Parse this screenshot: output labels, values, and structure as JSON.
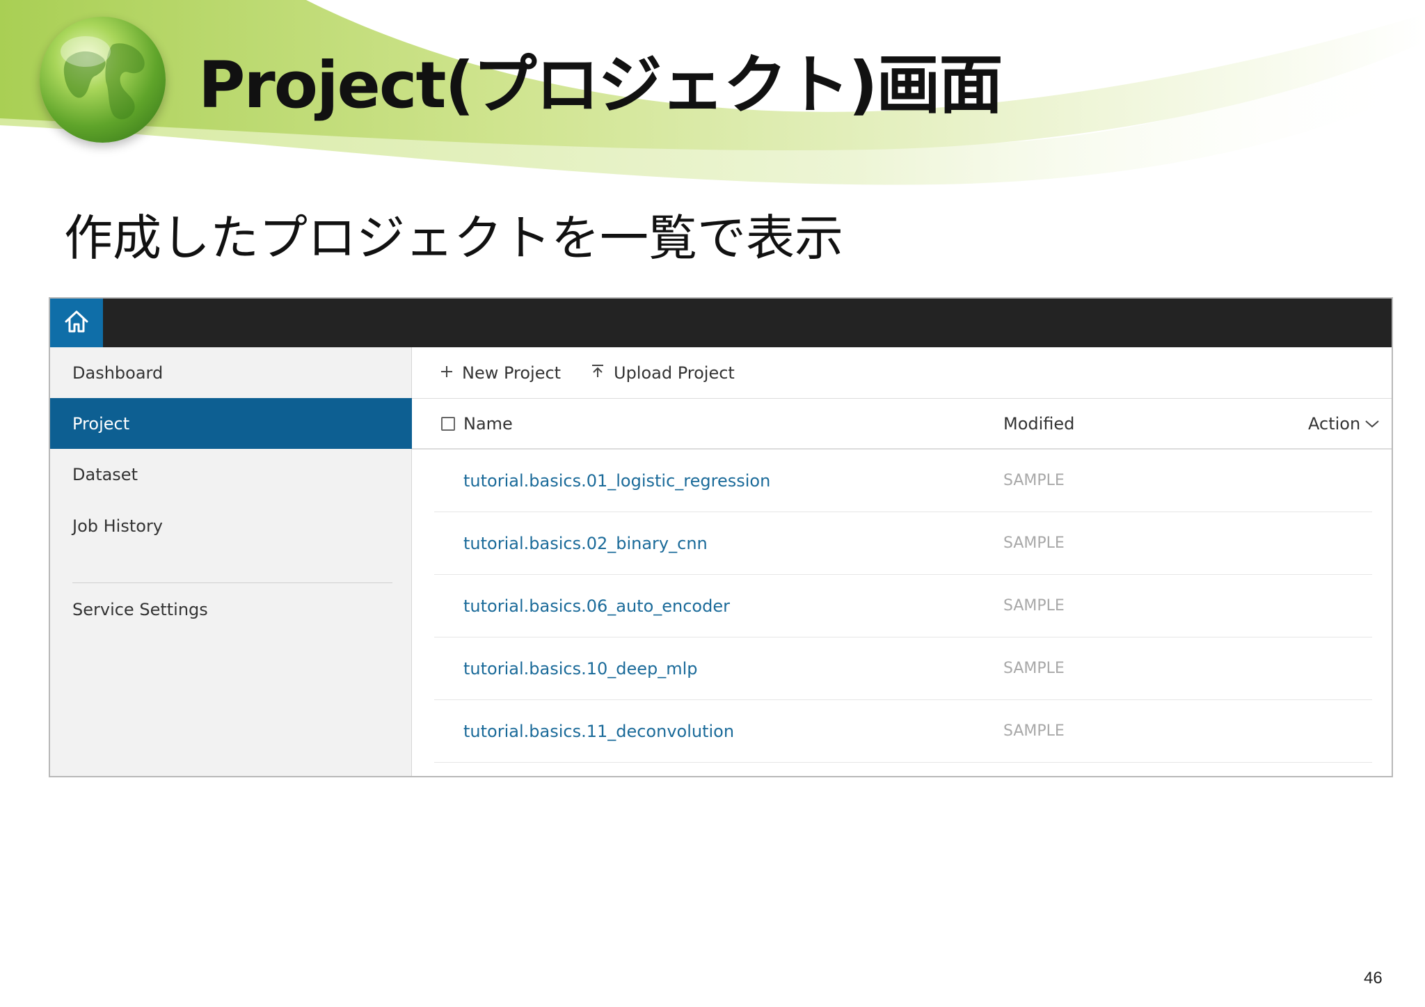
{
  "slide": {
    "title": "Project(プロジェクト)画面",
    "subtitle": "作成したプロジェクトを一覧で表示",
    "page_number": "46"
  },
  "app": {
    "home_icon": "home-icon",
    "sidebar": {
      "items": [
        {
          "label": "Dashboard",
          "active": false
        },
        {
          "label": "Project",
          "active": true
        },
        {
          "label": "Dataset",
          "active": false
        },
        {
          "label": "Job History",
          "active": false
        },
        {
          "label": "Service Settings",
          "active": false
        }
      ]
    },
    "toolbar": {
      "new_project": {
        "label": "New Project",
        "icon": "plus-icon"
      },
      "upload_project": {
        "label": "Upload Project",
        "icon": "upload-icon"
      }
    },
    "table": {
      "columns": {
        "name": "Name",
        "modified": "Modified",
        "action": "Action"
      },
      "rows": [
        {
          "name": "tutorial.basics.01_logistic_regression",
          "modified": "SAMPLE"
        },
        {
          "name": "tutorial.basics.02_binary_cnn",
          "modified": "SAMPLE"
        },
        {
          "name": "tutorial.basics.06_auto_encoder",
          "modified": "SAMPLE"
        },
        {
          "name": "tutorial.basics.10_deep_mlp",
          "modified": "SAMPLE"
        },
        {
          "name": "tutorial.basics.11_deconvolution",
          "modified": "SAMPLE"
        }
      ]
    }
  },
  "colors": {
    "accent": "#0d5f92",
    "topbar": "#232323",
    "link": "#1a6a99",
    "sidebar_bg": "#f2f2f2"
  }
}
